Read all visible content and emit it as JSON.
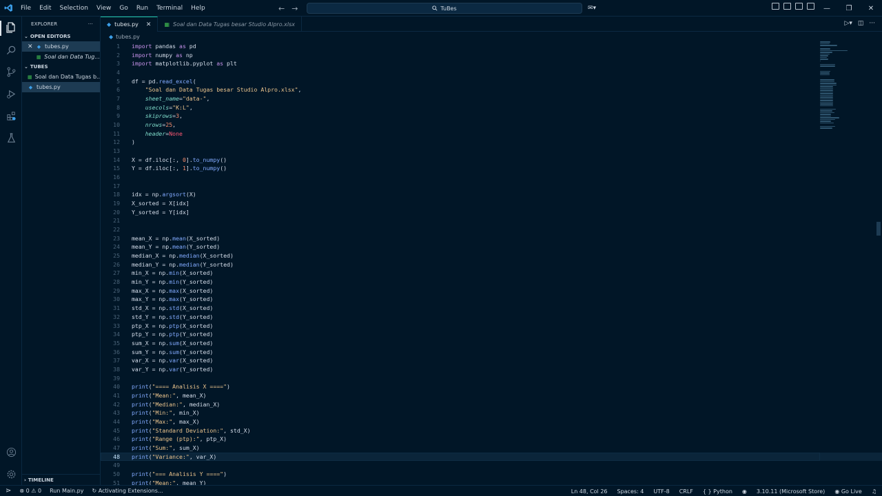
{
  "title_bar": {
    "menu": [
      "File",
      "Edit",
      "Selection",
      "View",
      "Go",
      "Run",
      "Terminal",
      "Help"
    ],
    "search_text": "TuBes"
  },
  "sidebar": {
    "header": "EXPLORER",
    "open_editors_label": "OPEN EDITORS",
    "open_editors": [
      {
        "name": "tubes.py",
        "type": "python"
      },
      {
        "name": "Soal dan Data Tug...",
        "type": "excel"
      }
    ],
    "folder_label": "TUBES",
    "files": [
      {
        "name": "Soal dan Data Tugas b...",
        "type": "excel"
      },
      {
        "name": "tubes.py",
        "type": "python"
      }
    ],
    "timeline_label": "TIMELINE"
  },
  "tabs": [
    {
      "label": "tubes.py",
      "type": "python",
      "active": true
    },
    {
      "label": "Soal dan Data Tugas besar Studio Alpro.xlsx",
      "type": "excel",
      "active": false
    }
  ],
  "breadcrumb": "tubes.py",
  "editor": {
    "current_line": 48,
    "lines": [
      [
        "1",
        [
          [
            "k",
            "import"
          ],
          [
            "t",
            " pandas "
          ],
          [
            "k",
            "as"
          ],
          [
            "t",
            " pd"
          ]
        ]
      ],
      [
        "2",
        [
          [
            "k",
            "import"
          ],
          [
            "t",
            " numpy "
          ],
          [
            "k",
            "as"
          ],
          [
            "t",
            " np"
          ]
        ]
      ],
      [
        "3",
        [
          [
            "k",
            "import"
          ],
          [
            "t",
            " matplotlib.pyplot "
          ],
          [
            "k",
            "as"
          ],
          [
            "t",
            " plt"
          ]
        ]
      ],
      [
        "4",
        []
      ],
      [
        "5",
        [
          [
            "t",
            "df = pd."
          ],
          [
            "f",
            "read_excel"
          ],
          [
            "t",
            "("
          ]
        ]
      ],
      [
        "6",
        [
          [
            "t",
            "    "
          ],
          [
            "s",
            "\"Soal dan Data Tugas besar Studio Alpro.xlsx\""
          ],
          [
            "t",
            ","
          ]
        ]
      ],
      [
        "7",
        [
          [
            "t",
            "    "
          ],
          [
            "pa",
            "sheet_name"
          ],
          [
            "t",
            "="
          ],
          [
            "s",
            "\"data-\""
          ],
          [
            "t",
            ","
          ]
        ]
      ],
      [
        "8",
        [
          [
            "t",
            "    "
          ],
          [
            "pa",
            "usecols"
          ],
          [
            "t",
            "="
          ],
          [
            "s",
            "\"K:L\""
          ],
          [
            "t",
            ","
          ]
        ]
      ],
      [
        "9",
        [
          [
            "t",
            "    "
          ],
          [
            "pa",
            "skiprows"
          ],
          [
            "t",
            "="
          ],
          [
            "p",
            "3"
          ],
          [
            "t",
            ","
          ]
        ]
      ],
      [
        "10",
        [
          [
            "t",
            "    "
          ],
          [
            "pa",
            "nrows"
          ],
          [
            "t",
            "="
          ],
          [
            "p",
            "25"
          ],
          [
            "t",
            ","
          ]
        ]
      ],
      [
        "11",
        [
          [
            "t",
            "    "
          ],
          [
            "pa",
            "header"
          ],
          [
            "t",
            "="
          ],
          [
            "n",
            "None"
          ]
        ]
      ],
      [
        "12",
        [
          [
            "t",
            ")"
          ]
        ]
      ],
      [
        "13",
        []
      ],
      [
        "14",
        [
          [
            "t",
            "X = df.iloc[:, "
          ],
          [
            "p",
            "0"
          ],
          [
            "t",
            "]."
          ],
          [
            "f",
            "to_numpy"
          ],
          [
            "t",
            "()"
          ]
        ]
      ],
      [
        "15",
        [
          [
            "t",
            "Y = df.iloc[:, "
          ],
          [
            "p",
            "1"
          ],
          [
            "t",
            "]."
          ],
          [
            "f",
            "to_numpy"
          ],
          [
            "t",
            "()"
          ]
        ]
      ],
      [
        "16",
        []
      ],
      [
        "17",
        []
      ],
      [
        "18",
        [
          [
            "t",
            "idx = np."
          ],
          [
            "f",
            "argsort"
          ],
          [
            "t",
            "(X)"
          ]
        ]
      ],
      [
        "19",
        [
          [
            "t",
            "X_sorted = X[idx]"
          ]
        ]
      ],
      [
        "20",
        [
          [
            "t",
            "Y_sorted = Y[idx]"
          ]
        ]
      ],
      [
        "21",
        []
      ],
      [
        "22",
        []
      ],
      [
        "23",
        [
          [
            "t",
            "mean_X = np."
          ],
          [
            "f",
            "mean"
          ],
          [
            "t",
            "(X_sorted)"
          ]
        ]
      ],
      [
        "24",
        [
          [
            "t",
            "mean_Y = np."
          ],
          [
            "f",
            "mean"
          ],
          [
            "t",
            "(Y_sorted)"
          ]
        ]
      ],
      [
        "25",
        [
          [
            "t",
            "median_X = np."
          ],
          [
            "f",
            "median"
          ],
          [
            "t",
            "(X_sorted)"
          ]
        ]
      ],
      [
        "26",
        [
          [
            "t",
            "median_Y = np."
          ],
          [
            "f",
            "median"
          ],
          [
            "t",
            "(Y_sorted)"
          ]
        ]
      ],
      [
        "27",
        [
          [
            "t",
            "min_X = np."
          ],
          [
            "f",
            "min"
          ],
          [
            "t",
            "(X_sorted)"
          ]
        ]
      ],
      [
        "28",
        [
          [
            "t",
            "min_Y = np."
          ],
          [
            "f",
            "min"
          ],
          [
            "t",
            "(Y_sorted)"
          ]
        ]
      ],
      [
        "29",
        [
          [
            "t",
            "max_X = np."
          ],
          [
            "f",
            "max"
          ],
          [
            "t",
            "(X_sorted)"
          ]
        ]
      ],
      [
        "30",
        [
          [
            "t",
            "max_Y = np."
          ],
          [
            "f",
            "max"
          ],
          [
            "t",
            "(Y_sorted)"
          ]
        ]
      ],
      [
        "31",
        [
          [
            "t",
            "std_X = np."
          ],
          [
            "f",
            "std"
          ],
          [
            "t",
            "(X_sorted)"
          ]
        ]
      ],
      [
        "32",
        [
          [
            "t",
            "std_Y = np."
          ],
          [
            "f",
            "std"
          ],
          [
            "t",
            "(Y_sorted)"
          ]
        ]
      ],
      [
        "33",
        [
          [
            "t",
            "ptp_X = np."
          ],
          [
            "f",
            "ptp"
          ],
          [
            "t",
            "(X_sorted)"
          ]
        ]
      ],
      [
        "34",
        [
          [
            "t",
            "ptp_Y = np."
          ],
          [
            "f",
            "ptp"
          ],
          [
            "t",
            "(Y_sorted)"
          ]
        ]
      ],
      [
        "35",
        [
          [
            "t",
            "sum_X = np."
          ],
          [
            "f",
            "sum"
          ],
          [
            "t",
            "(X_sorted)"
          ]
        ]
      ],
      [
        "36",
        [
          [
            "t",
            "sum_Y = np."
          ],
          [
            "f",
            "sum"
          ],
          [
            "t",
            "(Y_sorted)"
          ]
        ]
      ],
      [
        "37",
        [
          [
            "t",
            "var_X = np."
          ],
          [
            "f",
            "var"
          ],
          [
            "t",
            "(X_sorted)"
          ]
        ]
      ],
      [
        "38",
        [
          [
            "t",
            "var_Y = np."
          ],
          [
            "f",
            "var"
          ],
          [
            "t",
            "(Y_sorted)"
          ]
        ]
      ],
      [
        "39",
        []
      ],
      [
        "40",
        [
          [
            "f",
            "print"
          ],
          [
            "t",
            "("
          ],
          [
            "s",
            "\"==== Analisis X ====\""
          ],
          [
            "t",
            ")"
          ]
        ]
      ],
      [
        "41",
        [
          [
            "f",
            "print"
          ],
          [
            "t",
            "("
          ],
          [
            "s",
            "\"Mean:\""
          ],
          [
            "t",
            ", mean_X)"
          ]
        ]
      ],
      [
        "42",
        [
          [
            "f",
            "print"
          ],
          [
            "t",
            "("
          ],
          [
            "s",
            "\"Median:\""
          ],
          [
            "t",
            ", median_X)"
          ]
        ]
      ],
      [
        "43",
        [
          [
            "f",
            "print"
          ],
          [
            "t",
            "("
          ],
          [
            "s",
            "\"Min:\""
          ],
          [
            "t",
            ", min_X)"
          ]
        ]
      ],
      [
        "44",
        [
          [
            "f",
            "print"
          ],
          [
            "t",
            "("
          ],
          [
            "s",
            "\"Max:\""
          ],
          [
            "t",
            ", max_X)"
          ]
        ]
      ],
      [
        "45",
        [
          [
            "f",
            "print"
          ],
          [
            "t",
            "("
          ],
          [
            "s",
            "\"Standard Deviation:\""
          ],
          [
            "t",
            ", std_X)"
          ]
        ]
      ],
      [
        "46",
        [
          [
            "f",
            "print"
          ],
          [
            "t",
            "("
          ],
          [
            "s",
            "\"Range (ptp):\""
          ],
          [
            "t",
            ", ptp_X)"
          ]
        ]
      ],
      [
        "47",
        [
          [
            "f",
            "print"
          ],
          [
            "t",
            "("
          ],
          [
            "s",
            "\"Sum:\""
          ],
          [
            "t",
            ", sum_X)"
          ]
        ]
      ],
      [
        "48",
        [
          [
            "f",
            "print"
          ],
          [
            "t",
            "("
          ],
          [
            "s",
            "\"Variance:\""
          ],
          [
            "t",
            ", var_X)"
          ]
        ]
      ],
      [
        "49",
        []
      ],
      [
        "50",
        [
          [
            "f",
            "print"
          ],
          [
            "t",
            "("
          ],
          [
            "s",
            "\"=== Analisis Y ====\""
          ],
          [
            "t",
            ")"
          ]
        ]
      ],
      [
        "51",
        [
          [
            "f",
            "print"
          ],
          [
            "t",
            "("
          ],
          [
            "s",
            "\"Mean:\""
          ],
          [
            "t",
            ", mean_Y)"
          ]
        ]
      ]
    ]
  },
  "status": {
    "problems": "0",
    "warnings": "0",
    "run": "Run Main.py",
    "activity": "Activating Extensions...",
    "position": "Ln 48, Col 26",
    "spaces": "Spaces: 4",
    "encoding": "UTF-8",
    "eol": "CRLF",
    "language": "Python",
    "interpreter": "3.10.11 (Microsoft Store)",
    "golive": "Go Live"
  },
  "colors": {
    "bg": "#011627",
    "accent": "#21c7a8",
    "keyword": "#c792ea",
    "string": "#ecc48d",
    "number": "#f78c6c",
    "function": "#82aaff"
  }
}
